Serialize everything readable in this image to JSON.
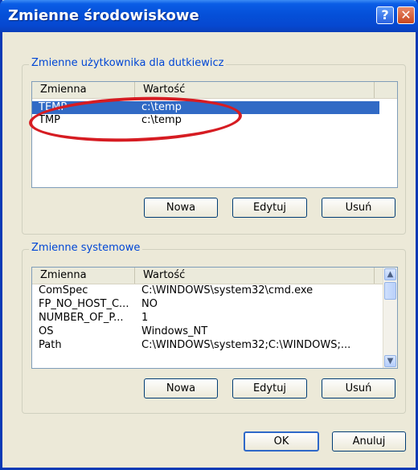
{
  "window": {
    "title": "Zmienne środowiskowe",
    "help_symbol": "?",
    "close_symbol": "✕"
  },
  "user_group": {
    "label": "Zmienne użytkownika dla dutkiewicz",
    "columns": [
      "Zmienna",
      "Wartość"
    ],
    "rows": [
      {
        "name": "TEMP",
        "value": "c:\\temp",
        "selected": true
      },
      {
        "name": "TMP",
        "value": "c:\\temp",
        "selected": false
      }
    ],
    "buttons": {
      "new": "Nowa",
      "edit": "Edytuj",
      "delete": "Usuń"
    }
  },
  "system_group": {
    "label": "Zmienne systemowe",
    "columns": [
      "Zmienna",
      "Wartość"
    ],
    "rows": [
      {
        "name": "ComSpec",
        "value": "C:\\WINDOWS\\system32\\cmd.exe"
      },
      {
        "name": "FP_NO_HOST_C...",
        "value": "NO"
      },
      {
        "name": "NUMBER_OF_P...",
        "value": "1"
      },
      {
        "name": "OS",
        "value": "Windows_NT"
      },
      {
        "name": "Path",
        "value": "C:\\WINDOWS\\system32;C:\\WINDOWS;..."
      }
    ],
    "buttons": {
      "new": "Nowa",
      "edit": "Edytuj",
      "delete": "Usuń"
    }
  },
  "dialog_buttons": {
    "ok": "OK",
    "cancel": "Anuluj"
  },
  "annotation": {
    "color": "#d61c22",
    "highlighted_row": "TEMP"
  },
  "colors": {
    "title_bar": "#0550d9",
    "selection": "#316ac5",
    "group_label": "#0046d5"
  },
  "icons": {
    "help": "help-icon",
    "close": "close-icon",
    "scroll_up": "chevron-up-icon",
    "scroll_down": "chevron-down-icon"
  }
}
